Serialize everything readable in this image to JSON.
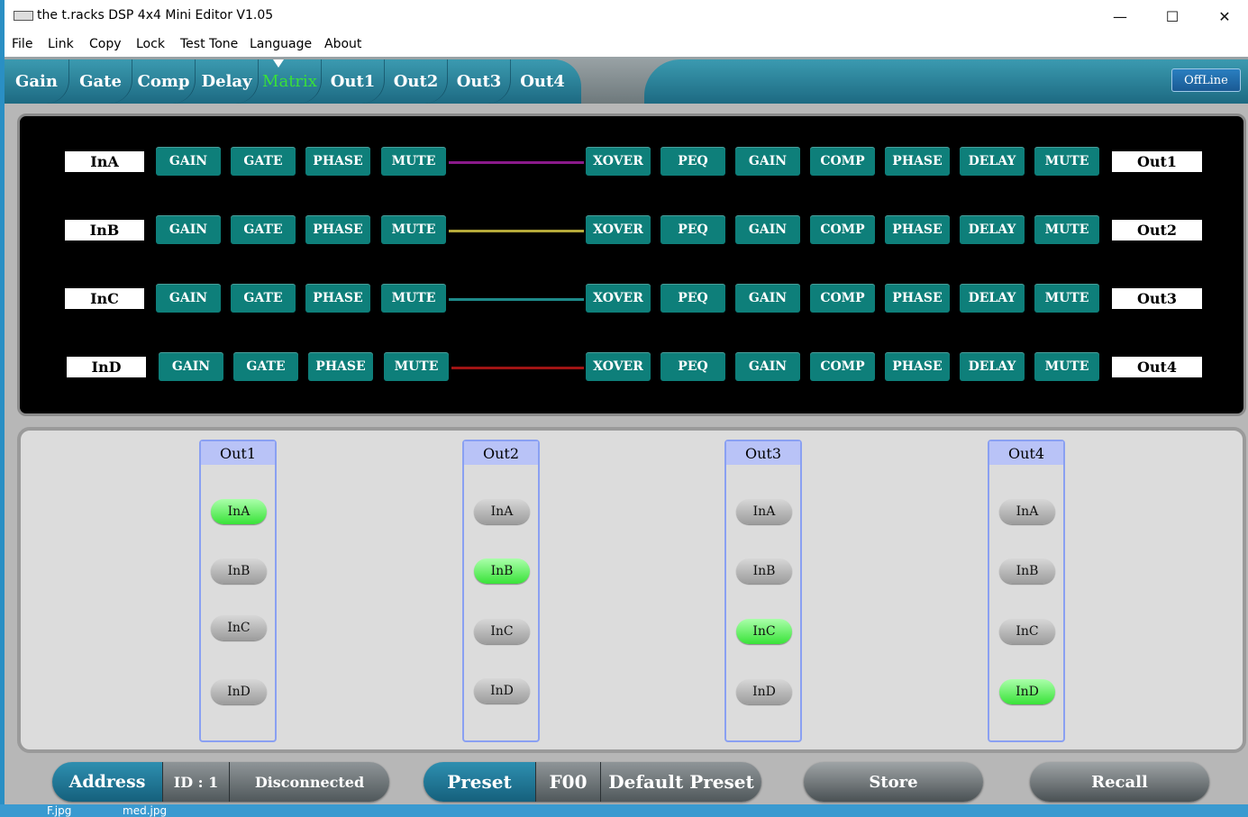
{
  "window": {
    "title": "the t.racks DSP 4x4 Mini Editor V1.05",
    "minimize": "—",
    "maximize": "☐",
    "close": "✕"
  },
  "menu": [
    "File",
    "Link",
    "Copy",
    "Lock",
    "Test Tone",
    "Language",
    "About"
  ],
  "tabs": [
    "Gain",
    "Gate",
    "Comp",
    "Delay",
    "Matrix",
    "Out1",
    "Out2",
    "Out3",
    "Out4"
  ],
  "active_tab": "Matrix",
  "connection_button": "OffLine",
  "signal_chain": {
    "input_blocks": [
      "GAIN",
      "GATE",
      "PHASE",
      "MUTE"
    ],
    "output_blocks": [
      "XOVER",
      "PEQ",
      "GAIN",
      "COMP",
      "PHASE",
      "DELAY",
      "MUTE"
    ],
    "channels": [
      {
        "input": "InA",
        "output": "Out1",
        "wire_color": "#8a1a8a"
      },
      {
        "input": "InB",
        "output": "Out2",
        "wire_color": "#b5aa3a"
      },
      {
        "input": "InC",
        "output": "Out3",
        "wire_color": "#1e8a8a"
      },
      {
        "input": "InD",
        "output": "Out4",
        "wire_color": "#a01414"
      }
    ]
  },
  "matrix": {
    "columns": [
      {
        "output": "Out1",
        "inputs": [
          "InA",
          "InB",
          "InC",
          "InD"
        ],
        "active": "InA"
      },
      {
        "output": "Out2",
        "inputs": [
          "InA",
          "InB",
          "InC",
          "InD"
        ],
        "active": "InB"
      },
      {
        "output": "Out3",
        "inputs": [
          "InA",
          "InB",
          "InC",
          "InD"
        ],
        "active": "InC"
      },
      {
        "output": "Out4",
        "inputs": [
          "InA",
          "InB",
          "InC",
          "InD"
        ],
        "active": "InD"
      }
    ]
  },
  "status": {
    "address_label": "Address",
    "id": "ID : 1",
    "connection": "Disconnected",
    "preset_label": "Preset",
    "preset_code": "F00",
    "preset_name": "Default Preset",
    "store": "Store",
    "recall": "Recall"
  },
  "taskbar": [
    "F.jpg",
    "med.jpg"
  ],
  "colors": {
    "block_teal": "#0e7f7a",
    "active_green": "#39e339",
    "tab_active": "#39e039"
  }
}
